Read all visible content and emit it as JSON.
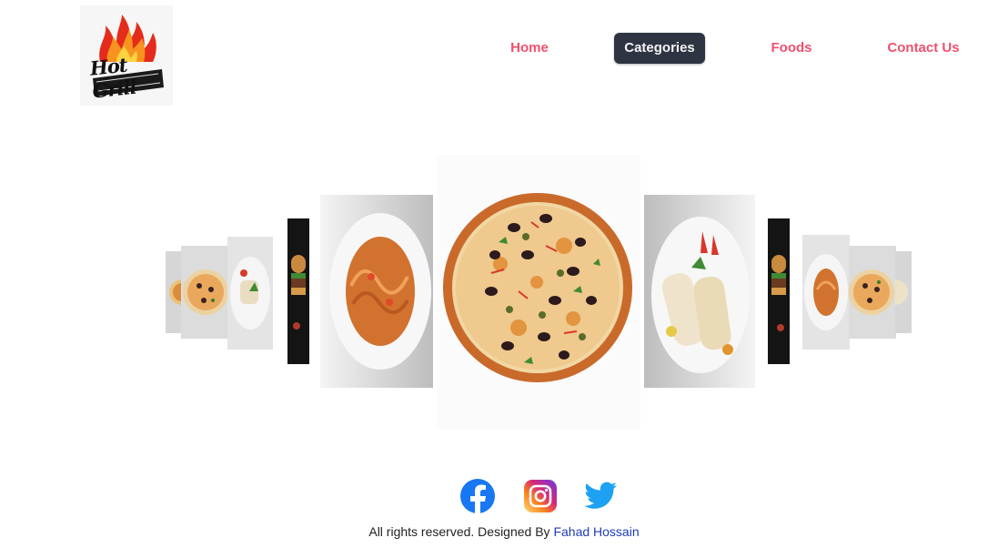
{
  "brand": {
    "logo_text": "Hot Grill"
  },
  "nav": {
    "items": [
      {
        "label": "Home",
        "active": false
      },
      {
        "label": "Categories",
        "active": true
      },
      {
        "label": "Foods",
        "active": false
      },
      {
        "label": "Contact Us",
        "active": false
      }
    ]
  },
  "carousel": {
    "slides": [
      {
        "dish": "pizza"
      },
      {
        "dish": "wrap"
      },
      {
        "dish": "burger"
      },
      {
        "dish": "spaghetti"
      },
      {
        "dish": "pizza"
      },
      {
        "dish": "spaghetti"
      },
      {
        "dish": "burger"
      },
      {
        "dish": "wrap"
      },
      {
        "dish": "pizza"
      },
      {
        "dish": "wrap"
      }
    ],
    "active_slide": 0
  },
  "footer": {
    "social": [
      {
        "icon": "facebook-icon",
        "color": "#1877f2"
      },
      {
        "icon": "instagram-icon",
        "color": "#d6249f"
      },
      {
        "icon": "twitter-icon",
        "color": "#1da1f2"
      }
    ],
    "copyright_text": "All rights reserved. Designed By",
    "author": "Fahad Hossain"
  },
  "colors": {
    "accent": "#f0506e",
    "active_bg": "#2f3442",
    "link": "#1f3bb8"
  }
}
